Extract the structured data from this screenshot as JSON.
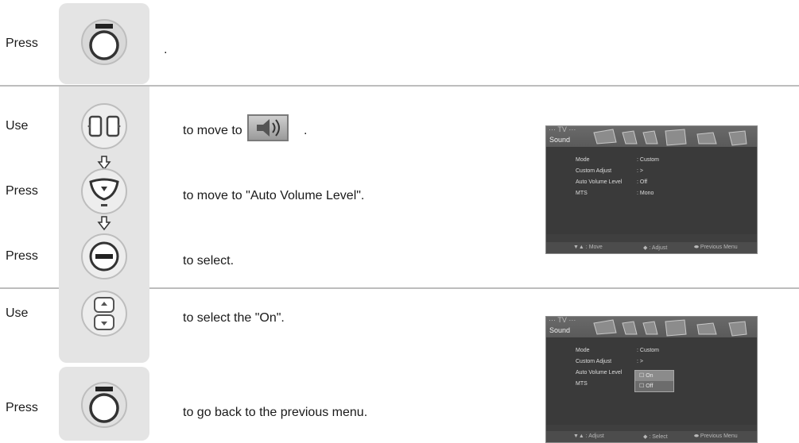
{
  "steps": {
    "press": "Press",
    "use": "Use",
    "dot": "."
  },
  "desc": {
    "move_to": "to move to",
    "move_to_auto": "to move to  \"Auto Volume Level\".",
    "to_select": "to select.",
    "select_on": "to select the \"On\".",
    "go_back": "to go back to the previous menu."
  },
  "osd": {
    "tv": "··· TV ···",
    "title": "Sound",
    "rows": [
      {
        "label": "Mode",
        "value": ": Custom"
      },
      {
        "label": "Custom Adjust",
        "value": ": >"
      },
      {
        "label": "Auto Volume Level",
        "value": ": Off"
      },
      {
        "label": "MTS",
        "value": ": Mono"
      }
    ],
    "footer1": [
      "▼▲ : Move",
      "◆ : Adjust",
      "⬬  Previous Menu"
    ],
    "footer2": [
      "▼▲ : Adjust",
      "◆ : Select",
      "⬬  Previous Menu"
    ],
    "popup": [
      "☐ On",
      "☐ Off"
    ]
  }
}
